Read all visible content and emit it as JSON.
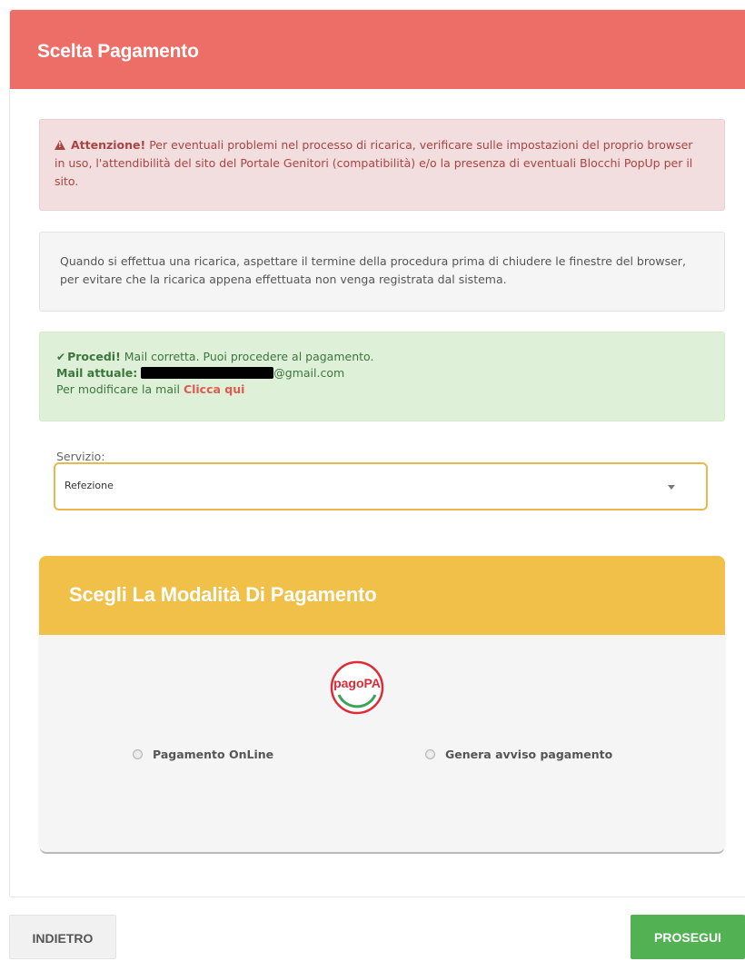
{
  "panel": {
    "title": "Scelta Pagamento"
  },
  "alerts": {
    "warning": {
      "strong": "Attenzione!",
      "text": " Per eventuali problemi nel processo di ricarica, verificare sulle impostazioni del proprio browser in uso, l'attendibilità del sito del Portale Genitori (compatibilità) e/o la presenza di eventuali Blocchi PopUp per il sito."
    },
    "info": {
      "text": "Quando si effettua una ricarica, aspettare il termine della procedura prima di chiudere le finestre del browser, per evitare che la ricarica appena effettuata non venga registrata dal sistema."
    },
    "success": {
      "strong": "Procedi!",
      "text": " Mail corretta. Puoi procedere al pagamento.",
      "mail_label": "Mail attuale:",
      "mail_domain": "@gmail.com",
      "change_text": "Per modificare la mail ",
      "change_link": "Clicca qui"
    }
  },
  "service": {
    "label": "Servizio:",
    "selected": "Refezione"
  },
  "payment": {
    "title": "Scegli La Modalità Di Pagamento",
    "logo_text": "pagoPA",
    "options": [
      {
        "label": "Pagamento OnLine"
      },
      {
        "label": "Genera avviso pagamento"
      }
    ]
  },
  "footer": {
    "back_label": "INDIETRO",
    "next_label": "PROSEGUI"
  },
  "colors": {
    "header": "#ec6e66",
    "payment_header": "#f0c048",
    "next_button": "#52b153",
    "select_border": "#e8b84a"
  }
}
